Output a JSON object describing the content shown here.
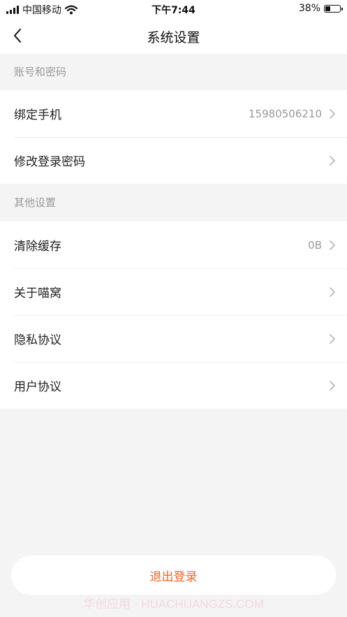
{
  "status_bar": {
    "carrier": "中国移动",
    "time": "下午7:44",
    "battery_percent": "38%",
    "battery_level": 0.38,
    "icons": [
      "signal-icon",
      "wifi-icon",
      "battery-icon"
    ]
  },
  "nav": {
    "title": "系统设置",
    "back_icon": "chevron-left-icon"
  },
  "sections": {
    "account": {
      "header": "账号和密码",
      "items": [
        {
          "label": "绑定手机",
          "value": "15980506210"
        },
        {
          "label": "修改登录密码",
          "value": ""
        }
      ]
    },
    "other": {
      "header": "其他设置",
      "items": [
        {
          "label": "清除缓存",
          "value": "0B"
        },
        {
          "label": "关于喵窝",
          "value": ""
        },
        {
          "label": "隐私协议",
          "value": ""
        },
        {
          "label": "用户协议",
          "value": ""
        }
      ]
    }
  },
  "logout": {
    "label": "退出登录"
  },
  "watermark": "华创应用 · HUACHUANGZS.COM",
  "colors": {
    "accent": "#f0642a",
    "background": "#f4f4f4",
    "secondary_text": "#999999"
  }
}
